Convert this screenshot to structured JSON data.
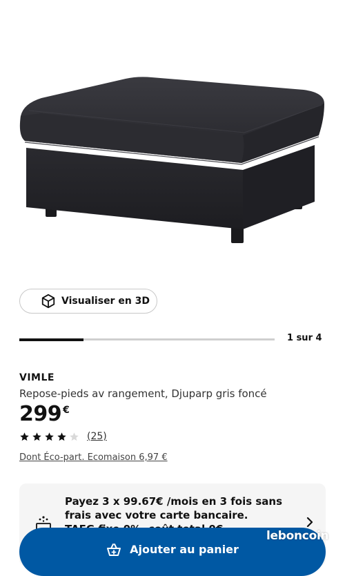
{
  "product_image": {
    "alt": "ottoman-image"
  },
  "visualize": {
    "label": "Visualiser en 3D",
    "icon": "cube-icon"
  },
  "gallery": {
    "counter": "1 sur 4",
    "progress_fraction": 0.25
  },
  "product": {
    "brand": "VIMLE",
    "description": "Repose-pieds av rangement, Djuparp gris foncé",
    "price": "299",
    "currency": "€",
    "rating_value": 4,
    "rating_max": 5,
    "rating_count": "(25)",
    "eco_fee": "Dont Éco-part. Ecomaison 6,97 €"
  },
  "payment": {
    "line1": "Payez 3 x 99.67€ /mois en 3 fois sans",
    "line2": "frais avec votre carte bancaire.",
    "line3": "TAEG fixe 0%, coût total 0€",
    "icon": "installment-icon"
  },
  "cart": {
    "label": "Ajouter au panier",
    "icon": "shopping-bag-icon"
  },
  "watermark": {
    "text": "leboncoin"
  },
  "colors": {
    "accent": "#0058a3",
    "star": "#111111",
    "star_empty": "#d9d9d9"
  }
}
